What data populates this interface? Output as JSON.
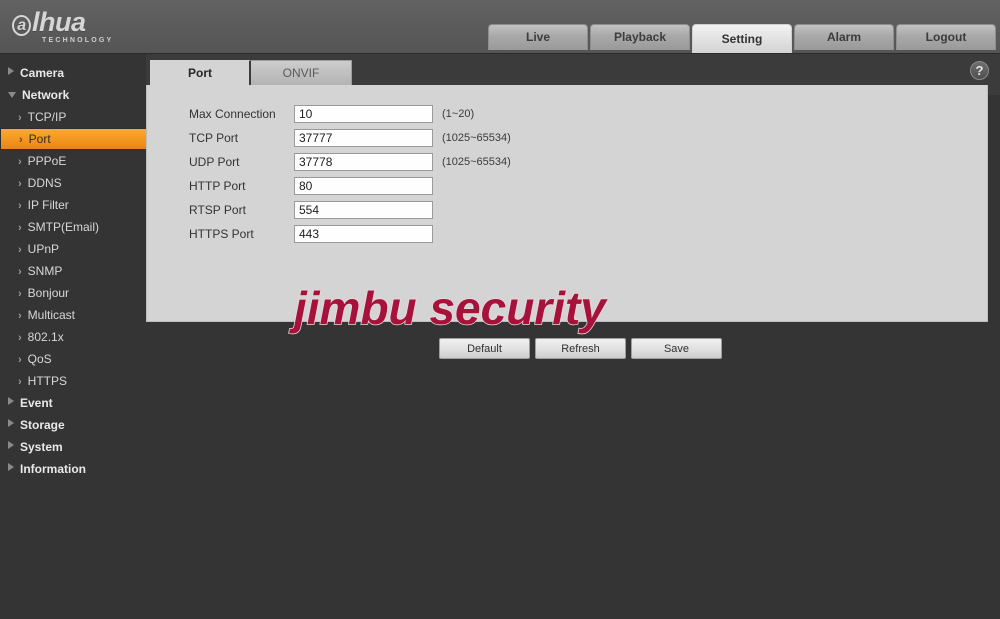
{
  "brand": {
    "logo_first": "a",
    "logo_rest": "lhua",
    "logo_sub": "TECHNOLOGY"
  },
  "topnav": {
    "tabs": [
      {
        "label": "Live",
        "active": false
      },
      {
        "label": "Playback",
        "active": false
      },
      {
        "label": "Setting",
        "active": true
      },
      {
        "label": "Alarm",
        "active": false
      },
      {
        "label": "Logout",
        "active": false
      }
    ]
  },
  "help": {
    "icon": "question-mark-icon",
    "label": "?"
  },
  "sidebar": {
    "groups": [
      {
        "label": "Camera",
        "expanded": false,
        "arrow": "triangle-right-icon",
        "items": []
      },
      {
        "label": "Network",
        "expanded": true,
        "arrow": "triangle-down-icon",
        "items": [
          {
            "label": "TCP/IP",
            "selected": false
          },
          {
            "label": "Port",
            "selected": true
          },
          {
            "label": "PPPoE",
            "selected": false
          },
          {
            "label": "DDNS",
            "selected": false
          },
          {
            "label": "IP Filter",
            "selected": false
          },
          {
            "label": "SMTP(Email)",
            "selected": false
          },
          {
            "label": "UPnP",
            "selected": false
          },
          {
            "label": "SNMP",
            "selected": false
          },
          {
            "label": "Bonjour",
            "selected": false
          },
          {
            "label": "Multicast",
            "selected": false
          },
          {
            "label": "802.1x",
            "selected": false
          },
          {
            "label": "QoS",
            "selected": false
          },
          {
            "label": "HTTPS",
            "selected": false
          }
        ]
      },
      {
        "label": "Event",
        "expanded": false,
        "arrow": "triangle-right-icon",
        "items": []
      },
      {
        "label": "Storage",
        "expanded": false,
        "arrow": "triangle-right-icon",
        "items": []
      },
      {
        "label": "System",
        "expanded": false,
        "arrow": "triangle-right-icon",
        "items": []
      },
      {
        "label": "Information",
        "expanded": false,
        "arrow": "triangle-right-icon",
        "items": []
      }
    ],
    "chevron": "›"
  },
  "subtabs": [
    {
      "label": "Port",
      "active": true
    },
    {
      "label": "ONVIF",
      "active": false
    }
  ],
  "form": {
    "fields": [
      {
        "label": "Max Connection",
        "value": "10",
        "hint": "(1~20)"
      },
      {
        "label": "TCP Port",
        "value": "37777",
        "hint": "(1025~65534)"
      },
      {
        "label": "UDP Port",
        "value": "37778",
        "hint": "(1025~65534)"
      },
      {
        "label": "HTTP Port",
        "value": "80",
        "hint": ""
      },
      {
        "label": "RTSP Port",
        "value": "554",
        "hint": ""
      },
      {
        "label": "HTTPS Port",
        "value": "443",
        "hint": ""
      }
    ]
  },
  "buttons": [
    {
      "label": "Default"
    },
    {
      "label": "Refresh"
    },
    {
      "label": "Save"
    }
  ],
  "watermark": {
    "text": "jimbu security",
    "color": "#a7123a"
  },
  "colors": {
    "accent_orange": "#f59a21",
    "header_gray": "#5a5a5a",
    "page_dark": "#343434",
    "panel_light": "#d4d4d4"
  }
}
